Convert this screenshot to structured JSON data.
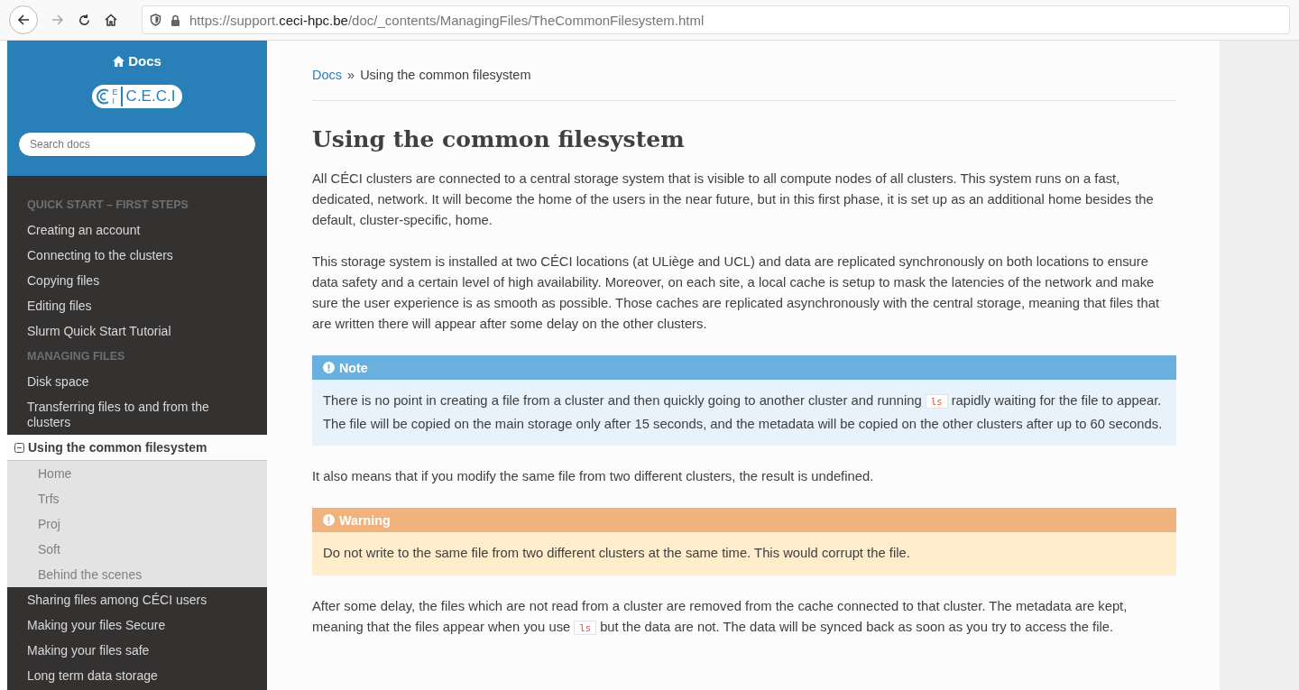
{
  "browser": {
    "url_host_prefix": "https://support.",
    "url_host": "ceci-hpc.be",
    "url_path": "/doc/_contents/ManagingFiles/TheCommonFilesystem.html"
  },
  "sidebar": {
    "home_link": "Docs",
    "logo_text": "C.E.C.I",
    "logo_small_top": "E",
    "logo_small_bottom": "I",
    "search": {
      "placeholder": "Search docs"
    },
    "nav": [
      {
        "kind": "caption",
        "text": "QUICK START – FIRST STEPS"
      },
      {
        "kind": "link",
        "text": "Creating an account",
        "selected": false
      },
      {
        "kind": "link",
        "text": "Connecting to the clusters",
        "selected": false
      },
      {
        "kind": "link",
        "text": "Copying files",
        "selected": false
      },
      {
        "kind": "link",
        "text": "Editing files",
        "selected": false
      },
      {
        "kind": "link",
        "text": "Slurm Quick Start Tutorial",
        "selected": false
      },
      {
        "kind": "caption",
        "text": "MANAGING FILES"
      },
      {
        "kind": "link",
        "text": "Disk space",
        "selected": false
      },
      {
        "kind": "link",
        "text": "Transferring files to and from the clusters",
        "selected": false
      },
      {
        "kind": "link",
        "text": "Using the common filesystem",
        "selected": true,
        "expanded": true,
        "children": [
          {
            "text": "Home"
          },
          {
            "text": "Trfs"
          },
          {
            "text": "Proj"
          },
          {
            "text": "Soft"
          },
          {
            "text": "Behind the scenes"
          }
        ]
      },
      {
        "kind": "link",
        "text": "Sharing files among CÉCI users",
        "selected": false
      },
      {
        "kind": "link",
        "text": "Making your files Secure",
        "selected": false
      },
      {
        "kind": "link",
        "text": "Making your files safe",
        "selected": false
      },
      {
        "kind": "link",
        "text": "Long term data storage",
        "selected": false
      }
    ]
  },
  "breadcrumb": {
    "link": "Docs",
    "separator": "»",
    "current": "Using the common filesystem"
  },
  "title": "Using the common filesystem",
  "blocks": [
    {
      "kind": "paragraph",
      "parts": [
        {
          "kind": "text",
          "text": "All CÉCI clusters are connected to a central storage system that is visible to all compute nodes of all clusters. This system runs on a fast, dedicated, network. It will become the home of the users in the near future, but in this first phase, it is set up as an additional home besides the default, cluster-specific, home."
        }
      ]
    },
    {
      "kind": "paragraph",
      "parts": [
        {
          "kind": "text",
          "text": "This storage system is installed at two CÉCI locations (at ULiège and UCL) and data are replicated synchronously on both locations to ensure data safety and a certain level of high availability. Moreover, on each site, a local cache is setup to mask the latencies of the network and make sure the user experience is as smooth as possible. Those caches are replicated asynchronously with the central storage, meaning that files that are written there will appear after some delay on the other clusters."
        }
      ]
    },
    {
      "kind": "note",
      "title": "Note",
      "parts": [
        {
          "kind": "text",
          "text": "There is no point in creating a file from a cluster and then quickly going to another cluster and running "
        },
        {
          "kind": "code",
          "text": "ls"
        },
        {
          "kind": "text",
          "text": " rapidly waiting for the file to appear. The file will be copied on the main storage only after 15 seconds, and the metadata will be copied on the other clusters after up to 60 seconds."
        }
      ]
    },
    {
      "kind": "paragraph",
      "parts": [
        {
          "kind": "text",
          "text": "It also means that if you modify the same file from two different clusters, the result is undefined."
        }
      ]
    },
    {
      "kind": "warning",
      "title": "Warning",
      "parts": [
        {
          "kind": "text",
          "text": "Do not write to the same file from two different clusters at the same time. This would corrupt the file."
        }
      ]
    },
    {
      "kind": "paragraph",
      "parts": [
        {
          "kind": "text",
          "text": "After some delay, the files which are not read from a cluster are removed from the cache connected to that cluster. The metadata are kept, meaning that the files appear when you use "
        },
        {
          "kind": "code",
          "text": "ls"
        },
        {
          "kind": "text",
          "text": " but the data are not. The data will be synced back as soon as you try to access the file."
        }
      ]
    }
  ]
}
